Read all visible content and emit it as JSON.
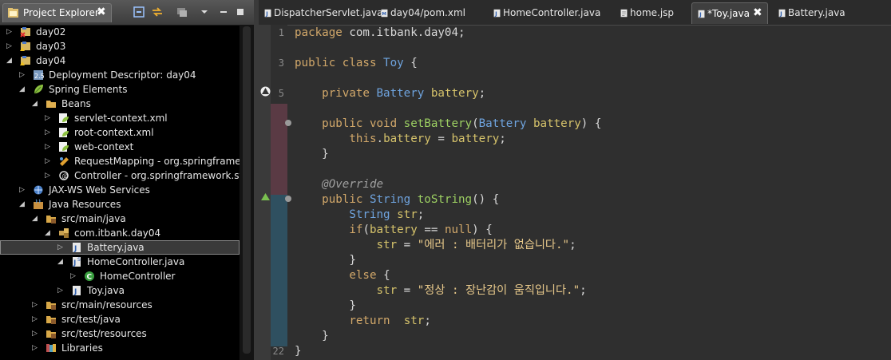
{
  "explorer": {
    "title": "Project Explorer",
    "close": "✖",
    "tree": [
      {
        "label": "day02",
        "depth": 0,
        "twisty": "closed",
        "icon": "project-error-icon"
      },
      {
        "label": "day03",
        "depth": 0,
        "twisty": "closed",
        "icon": "project-warning-icon"
      },
      {
        "label": "day04",
        "depth": 0,
        "twisty": "open",
        "icon": "project-warning-icon"
      },
      {
        "label": "Deployment Descriptor: day04",
        "depth": 1,
        "twisty": "closed",
        "icon": "deployment-descriptor-icon"
      },
      {
        "label": "Spring Elements",
        "depth": 1,
        "twisty": "open",
        "icon": "spring-leaf-icon"
      },
      {
        "label": "Beans",
        "depth": 2,
        "twisty": "open",
        "icon": "beans-folder-icon"
      },
      {
        "label": "servlet-context.xml",
        "depth": 3,
        "twisty": "closed",
        "icon": "spring-xml-icon"
      },
      {
        "label": "root-context.xml",
        "depth": 3,
        "twisty": "closed",
        "icon": "spring-xml-icon"
      },
      {
        "label": "web-context",
        "depth": 3,
        "twisty": "closed",
        "icon": "spring-xml-icon"
      },
      {
        "label": "RequestMapping - org.springframework",
        "depth": 3,
        "twisty": "closed",
        "icon": "request-mapping-icon"
      },
      {
        "label": "Controller - org.springframework.stere",
        "depth": 3,
        "twisty": "closed",
        "icon": "controller-annotation-icon"
      },
      {
        "label": "JAX-WS Web Services",
        "depth": 1,
        "twisty": "closed",
        "icon": "web-services-icon"
      },
      {
        "label": "Java Resources",
        "depth": 1,
        "twisty": "open",
        "icon": "java-resources-icon"
      },
      {
        "label": "src/main/java",
        "depth": 2,
        "twisty": "open",
        "icon": "source-folder-icon"
      },
      {
        "label": "com.itbank.day04",
        "depth": 3,
        "twisty": "open",
        "icon": "package-icon"
      },
      {
        "label": "Battery.java",
        "depth": 4,
        "twisty": "closed",
        "icon": "java-file-icon",
        "selected": true
      },
      {
        "label": "HomeController.java",
        "depth": 4,
        "twisty": "open",
        "icon": "java-file-spring-icon"
      },
      {
        "label": "HomeController",
        "depth": 5,
        "twisty": "closed",
        "icon": "class-icon"
      },
      {
        "label": "Toy.java",
        "depth": 4,
        "twisty": "closed",
        "icon": "java-file-icon"
      },
      {
        "label": "src/main/resources",
        "depth": 2,
        "twisty": "closed",
        "icon": "source-folder-icon"
      },
      {
        "label": "src/test/java",
        "depth": 2,
        "twisty": "closed",
        "icon": "source-folder-icon"
      },
      {
        "label": "src/test/resources",
        "depth": 2,
        "twisty": "closed",
        "icon": "source-folder-icon"
      },
      {
        "label": "Libraries",
        "depth": 2,
        "twisty": "closed",
        "icon": "libraries-icon"
      }
    ]
  },
  "editor": {
    "tabs": [
      {
        "label": "DispatcherServlet.java",
        "icon": "java-file-icon",
        "active": false
      },
      {
        "label": "day04/pom.xml",
        "icon": "pom-file-icon",
        "active": false
      },
      {
        "label": "HomeController.java",
        "icon": "java-file-icon",
        "active": false
      },
      {
        "label": "home.jsp",
        "icon": "jsp-file-icon",
        "active": false
      },
      {
        "label": "*Toy.java",
        "icon": "java-file-icon",
        "active": true,
        "close": "✖"
      },
      {
        "label": "Battery.java",
        "icon": "java-file-icon",
        "active": false
      }
    ],
    "line_numbers": [
      "1",
      "",
      "3",
      "",
      "5",
      "",
      "",
      "",
      "",
      "",
      "",
      "",
      "",
      "",
      "",
      "",
      "",
      "",
      "",
      "",
      "",
      "22"
    ],
    "lines": [
      [
        [
          "kw",
          "package "
        ],
        [
          "pl",
          "com.itbank.day04;"
        ]
      ],
      [],
      [
        [
          "kw",
          "public class "
        ],
        [
          "ty",
          "Toy "
        ],
        [
          "pl",
          "{"
        ]
      ],
      [],
      [
        [
          "pl",
          "    "
        ],
        [
          "kw",
          "private "
        ],
        [
          "ty",
          "Battery "
        ],
        [
          "vr",
          "battery"
        ],
        [
          "pl",
          ";"
        ]
      ],
      [],
      [
        [
          "pl",
          "    "
        ],
        [
          "kw",
          "public void "
        ],
        [
          "fn",
          "setBattery"
        ],
        [
          "pl",
          "("
        ],
        [
          "ty",
          "Battery "
        ],
        [
          "vr",
          "battery"
        ],
        [
          "pl",
          ") {"
        ]
      ],
      [
        [
          "pl",
          "        "
        ],
        [
          "kw",
          "this"
        ],
        [
          "pl",
          "."
        ],
        [
          "vr",
          "battery"
        ],
        [
          "pl",
          " = "
        ],
        [
          "vr",
          "battery"
        ],
        [
          "pl",
          ";"
        ]
      ],
      [
        [
          "pl",
          "    }"
        ]
      ],
      [],
      [
        [
          "pl",
          "    "
        ],
        [
          "an",
          "@Override"
        ]
      ],
      [
        [
          "pl",
          "    "
        ],
        [
          "kw",
          "public "
        ],
        [
          "ty",
          "String "
        ],
        [
          "fn",
          "toString"
        ],
        [
          "pl",
          "() {"
        ]
      ],
      [
        [
          "pl",
          "        "
        ],
        [
          "ty",
          "String "
        ],
        [
          "vr",
          "str"
        ],
        [
          "pl",
          ";"
        ]
      ],
      [
        [
          "pl",
          "        "
        ],
        [
          "kw",
          "if"
        ],
        [
          "pl",
          "("
        ],
        [
          "vr",
          "battery"
        ],
        [
          "pl",
          " == "
        ],
        [
          "kw",
          "null"
        ],
        [
          "pl",
          ") {"
        ]
      ],
      [
        [
          "pl",
          "            "
        ],
        [
          "vr",
          "str"
        ],
        [
          "pl",
          " = "
        ],
        [
          "st",
          "\"에러 : 배터리가 없습니다.\""
        ],
        [
          "pl",
          ";"
        ]
      ],
      [
        [
          "pl",
          "        }"
        ]
      ],
      [
        [
          "pl",
          "        "
        ],
        [
          "kw",
          "else "
        ],
        [
          "pl",
          "{"
        ]
      ],
      [
        [
          "pl",
          "            "
        ],
        [
          "vr",
          "str"
        ],
        [
          "pl",
          " = "
        ],
        [
          "st",
          "\"정상 : 장난감이 움직입니다.\""
        ],
        [
          "pl",
          ";"
        ]
      ],
      [
        [
          "pl",
          "        }"
        ]
      ],
      [
        [
          "pl",
          "        "
        ],
        [
          "kw",
          "return  "
        ],
        [
          "vr",
          "str"
        ],
        [
          "pl",
          ";"
        ]
      ],
      [
        [
          "pl",
          "    }"
        ]
      ],
      [
        [
          "pl",
          "}"
        ]
      ]
    ]
  }
}
